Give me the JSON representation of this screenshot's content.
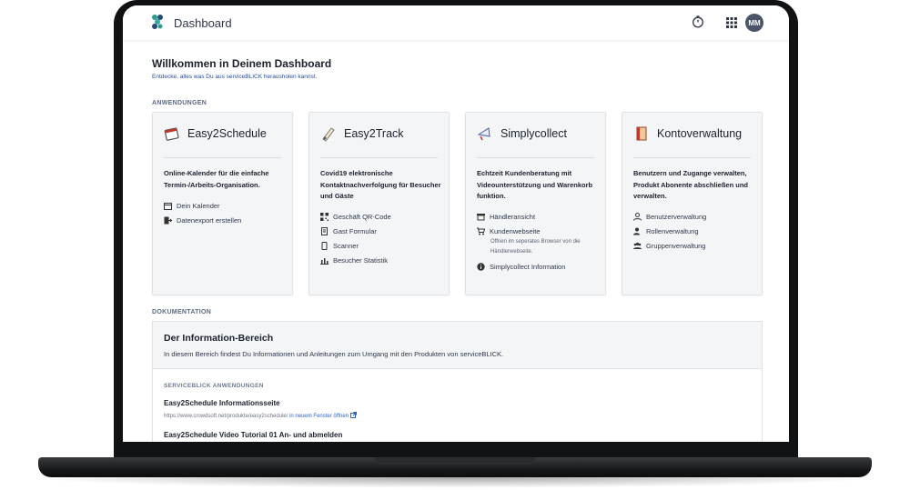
{
  "header": {
    "title": "Dashboard",
    "avatar_initials": "MM",
    "icons": [
      "logo-icon",
      "timer-icon",
      "apps-grid-icon"
    ]
  },
  "welcome": {
    "title": "Willkommen in Deinem Dashboard",
    "subtitle": "Entdecke, alles was Du aus serviceBLICK herausholen kannst."
  },
  "sections": {
    "apps": "ANWENDUNGEN",
    "docs": "DOKUMENTATION"
  },
  "cards": [
    {
      "title": "Easy2Schedule",
      "description": "Online-Kalender für die einfache Termin-/Arbeits-Organisation.",
      "links": [
        {
          "label": "Dein Kalender",
          "icon": "calendar-icon"
        },
        {
          "label": "Datenexport erstellen",
          "icon": "export-icon"
        }
      ]
    },
    {
      "title": "Easy2Track",
      "description": "Covid19 elektronische Kontaktnachverfolgung für Besucher und Gäste",
      "links": [
        {
          "label": "Geschäft QR-Code",
          "icon": "qr-code-icon"
        },
        {
          "label": "Gast Formular",
          "icon": "document-icon"
        },
        {
          "label": "Scanner",
          "icon": "mobile-icon"
        },
        {
          "label": "Besucher Statistik",
          "icon": "chart-icon"
        }
      ]
    },
    {
      "title": "Simplycollect",
      "description": "Echtzeit Kundenberatung mit Videounterstützung und Warenkorb funktion.",
      "links": [
        {
          "label": "Händleransicht",
          "icon": "store-icon"
        },
        {
          "label": "Kundenwebseite",
          "icon": "cart-icon",
          "note": "Offnen im seperates Browser von die Händlerwebseite."
        },
        {
          "label": "Simplycollect Information",
          "icon": "info-icon"
        }
      ]
    },
    {
      "title": "Kontoverwaltung",
      "description": "Benutzern und Zugange verwalten, Produkt Abonente abschließen und verwalten.",
      "links": [
        {
          "label": "Benutzerverwaltung",
          "icon": "user-icon"
        },
        {
          "label": "Rollenverwaltung",
          "icon": "user-role-icon"
        },
        {
          "label": "Gruppenverwaltung",
          "icon": "users-icon"
        }
      ]
    }
  ],
  "docs": {
    "title": "Der Information-Bereich",
    "subtitle": "In diesem Bereich findest Du Informationen und Anleitungen zum Umgang mit den Produkten von serviceBLICK.",
    "group_label": "SERVICEBLICK ANWENDUNGEN",
    "items": [
      {
        "title": "Easy2Schedule Informationsseite",
        "url": "https://www.crowdsoft.net/produkte/easy2schedule/",
        "link_label": "in neuem Fenster öffnen"
      },
      {
        "title": "Easy2Schedule Video Tutorial 01 An- und abmelden"
      }
    ]
  }
}
